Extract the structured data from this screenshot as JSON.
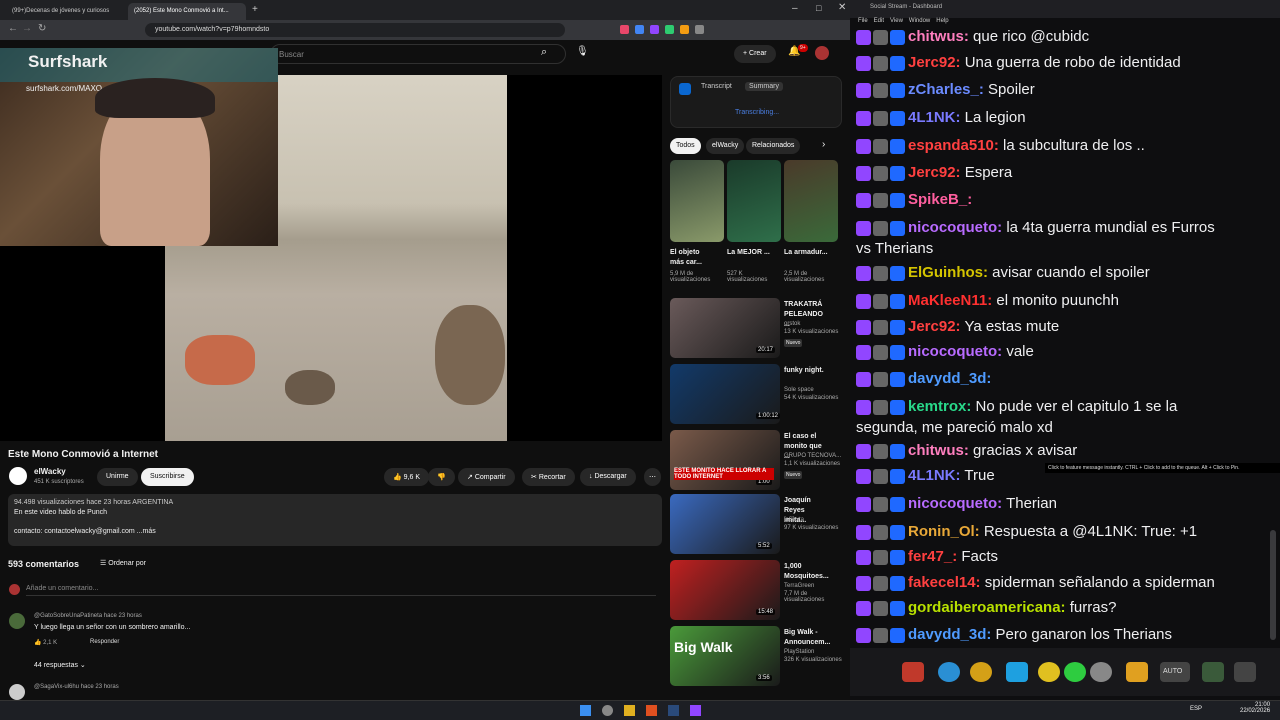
{
  "browser": {
    "tabs": [
      "(99+)Decenas de jóvenes y curiosos",
      "(2052) Este Mono Conmovió a Int..."
    ],
    "url": "youtube.com/watch?v=p79homndsto"
  },
  "yt": {
    "search_placeholder": "Buscar",
    "create_label": "Crear",
    "notif_count": "9+",
    "webcam": {
      "brand": "Surfshark",
      "promo": "surfshark.com/MAXO"
    },
    "title": "Este Mono Conmovió a Internet",
    "channel": "elWacky",
    "subs": "451 K suscriptores",
    "join": "Unirme",
    "subscribe": "Suscribirse",
    "likes": "9,6 K",
    "share": "Compartir",
    "clip": "Recortar",
    "download": "Descargar",
    "desc_line1": "94.498 visualizaciones  hace 23 horas  ARGENTINA",
    "desc_line2": "En este video hablo de Punch",
    "desc_line3": "contacto: contactoelwacky@gmail.com  ...más",
    "comments_count": "593 comentarios",
    "sort": "Ordenar por",
    "add_comment": "Añade un comentario...",
    "comment1_user": "@GatoSobreUnaPatineta hace 23 horas",
    "comment1_text": "Y luego llega un señor con un sombrero amarillo...",
    "comment1_likes": "2,1 K",
    "reply": "Responder",
    "replies": "44 respuestas",
    "comment2_user": "@SagaVix-ul6hu hace 23 horas",
    "transcript": "Transcript",
    "summary": "Summary",
    "transcribing": "Transcribing...",
    "chips": [
      "Todos",
      "elWacky",
      "Relacionados"
    ],
    "shorts": [
      {
        "title": "El objeto más car...",
        "views": "5,9 M de visualizaciones"
      },
      {
        "title": "La MEJOR ...",
        "views": "527 K visualizaciones"
      },
      {
        "title": "La armadur...",
        "views": "2,5 M de visualizaciones"
      }
    ],
    "recs": [
      {
        "title": "TRAKATRÁ PELEANDO ...",
        "ch": "orstok",
        "views": "13 K visualizaciones",
        "badge": "Nuevo",
        "dur": "20:17"
      },
      {
        "title": "funky night.",
        "ch": "Sole space",
        "views": "54 K visualizaciones",
        "badge": "",
        "dur": "1:00:12"
      },
      {
        "title": "El caso el monito que ...",
        "ch": "GRUPO TECNOVA...",
        "views": "1,1 K visualizaciones",
        "badge": "Nuevo",
        "dur": "1:00"
      },
      {
        "title": "Joaquín Reyes imita...",
        "ch": "laSexta",
        "views": "97 K visualizaciones",
        "badge": "",
        "dur": "5:52"
      },
      {
        "title": "1,000 Mosquitoes...",
        "ch": "TerraGreen",
        "views": "7,7 M de visualizaciones",
        "badge": "",
        "dur": "15:48"
      },
      {
        "title": "Big Walk - Announcem...",
        "ch": "PlayStation",
        "views": "326 K visualizaciones",
        "badge": "",
        "dur": "3:56"
      }
    ],
    "thumb_text": {
      "t3": "ESTE MONITO HACE LLORAR A TODO INTERNET",
      "t6": "Big Walk"
    }
  },
  "chat": {
    "title": "Social Stream - Dashboard",
    "menu": [
      "File",
      "Edit",
      "View",
      "Window",
      "Help"
    ],
    "lines": [
      {
        "name": "chitwus:",
        "color": "#ff7fbf",
        "text": " que rico @cubidc"
      },
      {
        "name": "Jerc92:",
        "color": "#ff4040",
        "text": " Una guerra de robo de identidad"
      },
      {
        "name": "zCharles_:",
        "color": "#6b8bff",
        "text": " Spoiler"
      },
      {
        "name": "4L1NK:",
        "color": "#7a7aff",
        "text": " La legion"
      },
      {
        "name": "espanda510:",
        "color": "#ff4040",
        "text": " la subcultura de los .."
      },
      {
        "name": "Jerc92:",
        "color": "#ff4040",
        "text": " Espera"
      },
      {
        "name": "SpikeB_:",
        "color": "#ff5f9f",
        "text": ""
      },
      {
        "name": "nicocoqueto:",
        "color": "#b86bff",
        "text": " la 4ta guerra mundial es Furros"
      },
      {
        "name": "",
        "color": "#efeff1",
        "text": "vs Therians"
      },
      {
        "name": "ElGuinhos:",
        "color": "#d4c400",
        "text": " avisar cuando"
      },
      {
        "name": "MaKleeN11:",
        "color": "#ff3030",
        "text": " el monito puunchh"
      },
      {
        "name": "Jerc92:",
        "color": "#ff4040",
        "text": " Ya estas mute"
      },
      {
        "name": "nicocoqueto:",
        "color": "#b86bff",
        "text": " vale"
      },
      {
        "name": "davydd_3d:",
        "color": "#4f9bff",
        "text": ""
      },
      {
        "name": "kemtrox:",
        "color": "#29d98a",
        "text": " No pude ver el capitulo 1 se la"
      },
      {
        "name": "",
        "color": "#efeff1",
        "text": "segunda, me pareció malo xd"
      },
      {
        "name": "chitwus:",
        "color": "#ff7fbf",
        "text": " gracias x avisar"
      },
      {
        "name": "4L1NK:",
        "color": "#7a7aff",
        "text": " True"
      },
      {
        "name": "nicocoqueto:",
        "color": "#b86bff",
        "text": " Therian"
      },
      {
        "name": "Ronin_Ol:",
        "color": "#e8a838",
        "text": " Respuesta a @4L1NK: True: +1"
      },
      {
        "name": "fer47_:",
        "color": "#ff4040",
        "text": " Facts"
      },
      {
        "name": "fakecel14:",
        "color": "#ff4040",
        "text": " spiderman señalando a spiderman"
      },
      {
        "name": "gordaiberoamericana:",
        "color": "#b8e000",
        "text": " furras?"
      },
      {
        "name": "davydd_3d:",
        "color": "#4f9bff",
        "text": " Pero ganaron los Therians"
      }
    ],
    "extra": {
      "elguinhos_tail": " el spoiler"
    },
    "tooltip": "Click to feature message instantly. CTRL + Click to add to the queue. Alt + Click to Pin.",
    "auto": "AUTO"
  },
  "taskbar": {
    "time": "21:00",
    "date": "22/02/2026",
    "lang": "ESP"
  }
}
